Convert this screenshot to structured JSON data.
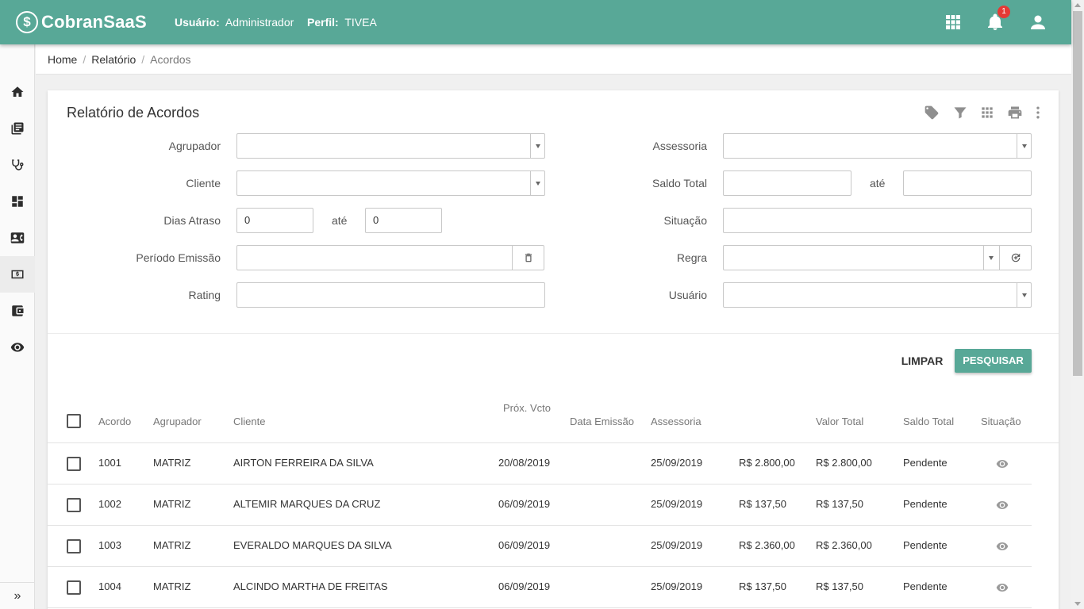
{
  "app": {
    "name": "CobranSaaS"
  },
  "header": {
    "user_label": "Usuário:",
    "user_value": "Administrador",
    "perfil_label": "Perfil:",
    "perfil_value": "TIVEA",
    "notification_count": "1"
  },
  "sidebar": {
    "items": [
      {
        "icon": "home-icon"
      },
      {
        "icon": "book-icon"
      },
      {
        "icon": "stethoscope-icon"
      },
      {
        "icon": "dashboard-icon"
      },
      {
        "icon": "contact-card-icon"
      },
      {
        "icon": "money-icon"
      },
      {
        "icon": "wallet-icon"
      },
      {
        "icon": "eye-icon"
      }
    ],
    "active_index": 5,
    "expand_label": "»"
  },
  "breadcrumb": {
    "home": "Home",
    "relatorio": "Relatório",
    "current": "Acordos"
  },
  "page": {
    "title": "Relatório de Acordos"
  },
  "toolbar_icons": [
    "tag-icon",
    "filter-icon",
    "grid-icon",
    "print-icon",
    "more-vert-icon"
  ],
  "filters": {
    "agrupador": {
      "label": "Agrupador",
      "value": ""
    },
    "cliente": {
      "label": "Cliente",
      "value": ""
    },
    "dias_atraso": {
      "label": "Dias Atraso",
      "from": "0",
      "ate": "até",
      "to": "0"
    },
    "periodo_emissao": {
      "label": "Período Emissão",
      "value": ""
    },
    "rating": {
      "label": "Rating",
      "value": ""
    },
    "assessoria": {
      "label": "Assessoria",
      "value": ""
    },
    "saldo_total": {
      "label": "Saldo Total",
      "from": "",
      "ate": "até",
      "to": ""
    },
    "situacao": {
      "label": "Situação",
      "value": ""
    },
    "regra": {
      "label": "Regra",
      "value": ""
    },
    "usuario": {
      "label": "Usuário",
      "value": ""
    }
  },
  "actions": {
    "limpar": "LIMPAR",
    "pesquisar": "PESQUISAR"
  },
  "table": {
    "columns": {
      "acordo": "Acordo",
      "agrupador": "Agrupador",
      "cliente": "Cliente",
      "prox_vcto": "Próx. Vcto",
      "data_emissao": "Data Emissão",
      "assessoria": "Assessoria",
      "valor_total": "Valor Total",
      "saldo_total": "Saldo Total",
      "situacao": "Situação"
    },
    "rows": [
      {
        "acordo": "1001",
        "agrupador": "MATRIZ",
        "cliente": "AIRTON FERREIRA DA SILVA",
        "prox_vcto": "20/08/2019",
        "data_emissao": "25/09/2019",
        "valor": "R$ 2.800,00",
        "saldo": "R$ 2.800,00",
        "situacao": "Pendente"
      },
      {
        "acordo": "1002",
        "agrupador": "MATRIZ",
        "cliente": "ALTEMIR MARQUES DA CRUZ",
        "prox_vcto": "06/09/2019",
        "data_emissao": "25/09/2019",
        "valor": "R$ 137,50",
        "saldo": "R$ 137,50",
        "situacao": "Pendente"
      },
      {
        "acordo": "1003",
        "agrupador": "MATRIZ",
        "cliente": "EVERALDO MARQUES DA SILVA",
        "prox_vcto": "06/09/2019",
        "data_emissao": "25/09/2019",
        "valor": "R$ 2.360,00",
        "saldo": "R$ 2.360,00",
        "situacao": "Pendente"
      },
      {
        "acordo": "1004",
        "agrupador": "MATRIZ",
        "cliente": "ALCINDO MARTHA DE FREITAS",
        "prox_vcto": "06/09/2019",
        "data_emissao": "25/09/2019",
        "valor": "R$ 137,50",
        "saldo": "R$ 137,50",
        "situacao": "Pendente"
      }
    ]
  },
  "colors": {
    "brand": "#58a897",
    "badge": "#e53935"
  }
}
